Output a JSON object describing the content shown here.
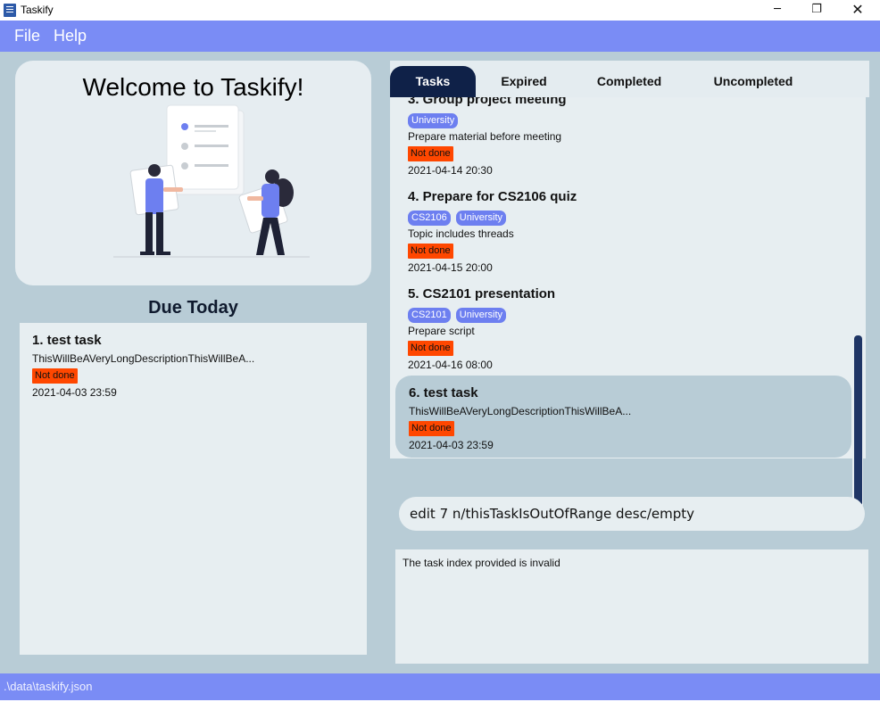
{
  "window": {
    "title": "Taskify",
    "minimize_glyph": "─",
    "maximize_glyph": "❐",
    "close_glyph": "✕"
  },
  "menu": {
    "file": "File",
    "help": "Help"
  },
  "welcome": {
    "title": "Welcome to Taskify!"
  },
  "due_today": {
    "title": "Due Today",
    "items": [
      {
        "name": "1.  test task",
        "description": "ThisWillBeAVeryLongDescriptionThisWillBeA...",
        "status": "Not done",
        "date": "2021-04-03 23:59"
      }
    ]
  },
  "tabs": [
    {
      "label": "Tasks",
      "active": true
    },
    {
      "label": "Expired",
      "active": false
    },
    {
      "label": "Completed",
      "active": false
    },
    {
      "label": "Uncompleted",
      "active": false
    }
  ],
  "tasks": [
    {
      "name": "3.  Group project meeting",
      "tags": [
        "University"
      ],
      "description": "Prepare material before meeting",
      "status": "Not done",
      "date": "2021-04-14 20:30"
    },
    {
      "name": "4.  Prepare for CS2106 quiz",
      "tags": [
        "CS2106",
        "University"
      ],
      "description": "Topic includes threads",
      "status": "Not done",
      "date": "2021-04-15 20:00"
    },
    {
      "name": "5.  CS2101 presentation",
      "tags": [
        "CS2101",
        "University"
      ],
      "description": "Prepare script",
      "status": "Not done",
      "date": "2021-04-16 08:00"
    },
    {
      "name": "6.  test task",
      "tags": [],
      "description": "ThisWillBeAVeryLongDescriptionThisWillBeA...",
      "status": "Not done",
      "date": "2021-04-03 23:59"
    }
  ],
  "command": {
    "value": "edit 7 n/thisTaskIsOutOfRange desc/empty"
  },
  "result": {
    "text": "The task index provided is invalid"
  },
  "status_bar": {
    "path": ".\\data\\taskify.json"
  },
  "colors": {
    "menu_bar": "#7a8cf5",
    "background": "#b8ccd6",
    "active_tab": "#0f2148",
    "tag": "#6d7ff0",
    "status_not_done": "#ff4700",
    "scrollbar": "#1f3565"
  }
}
